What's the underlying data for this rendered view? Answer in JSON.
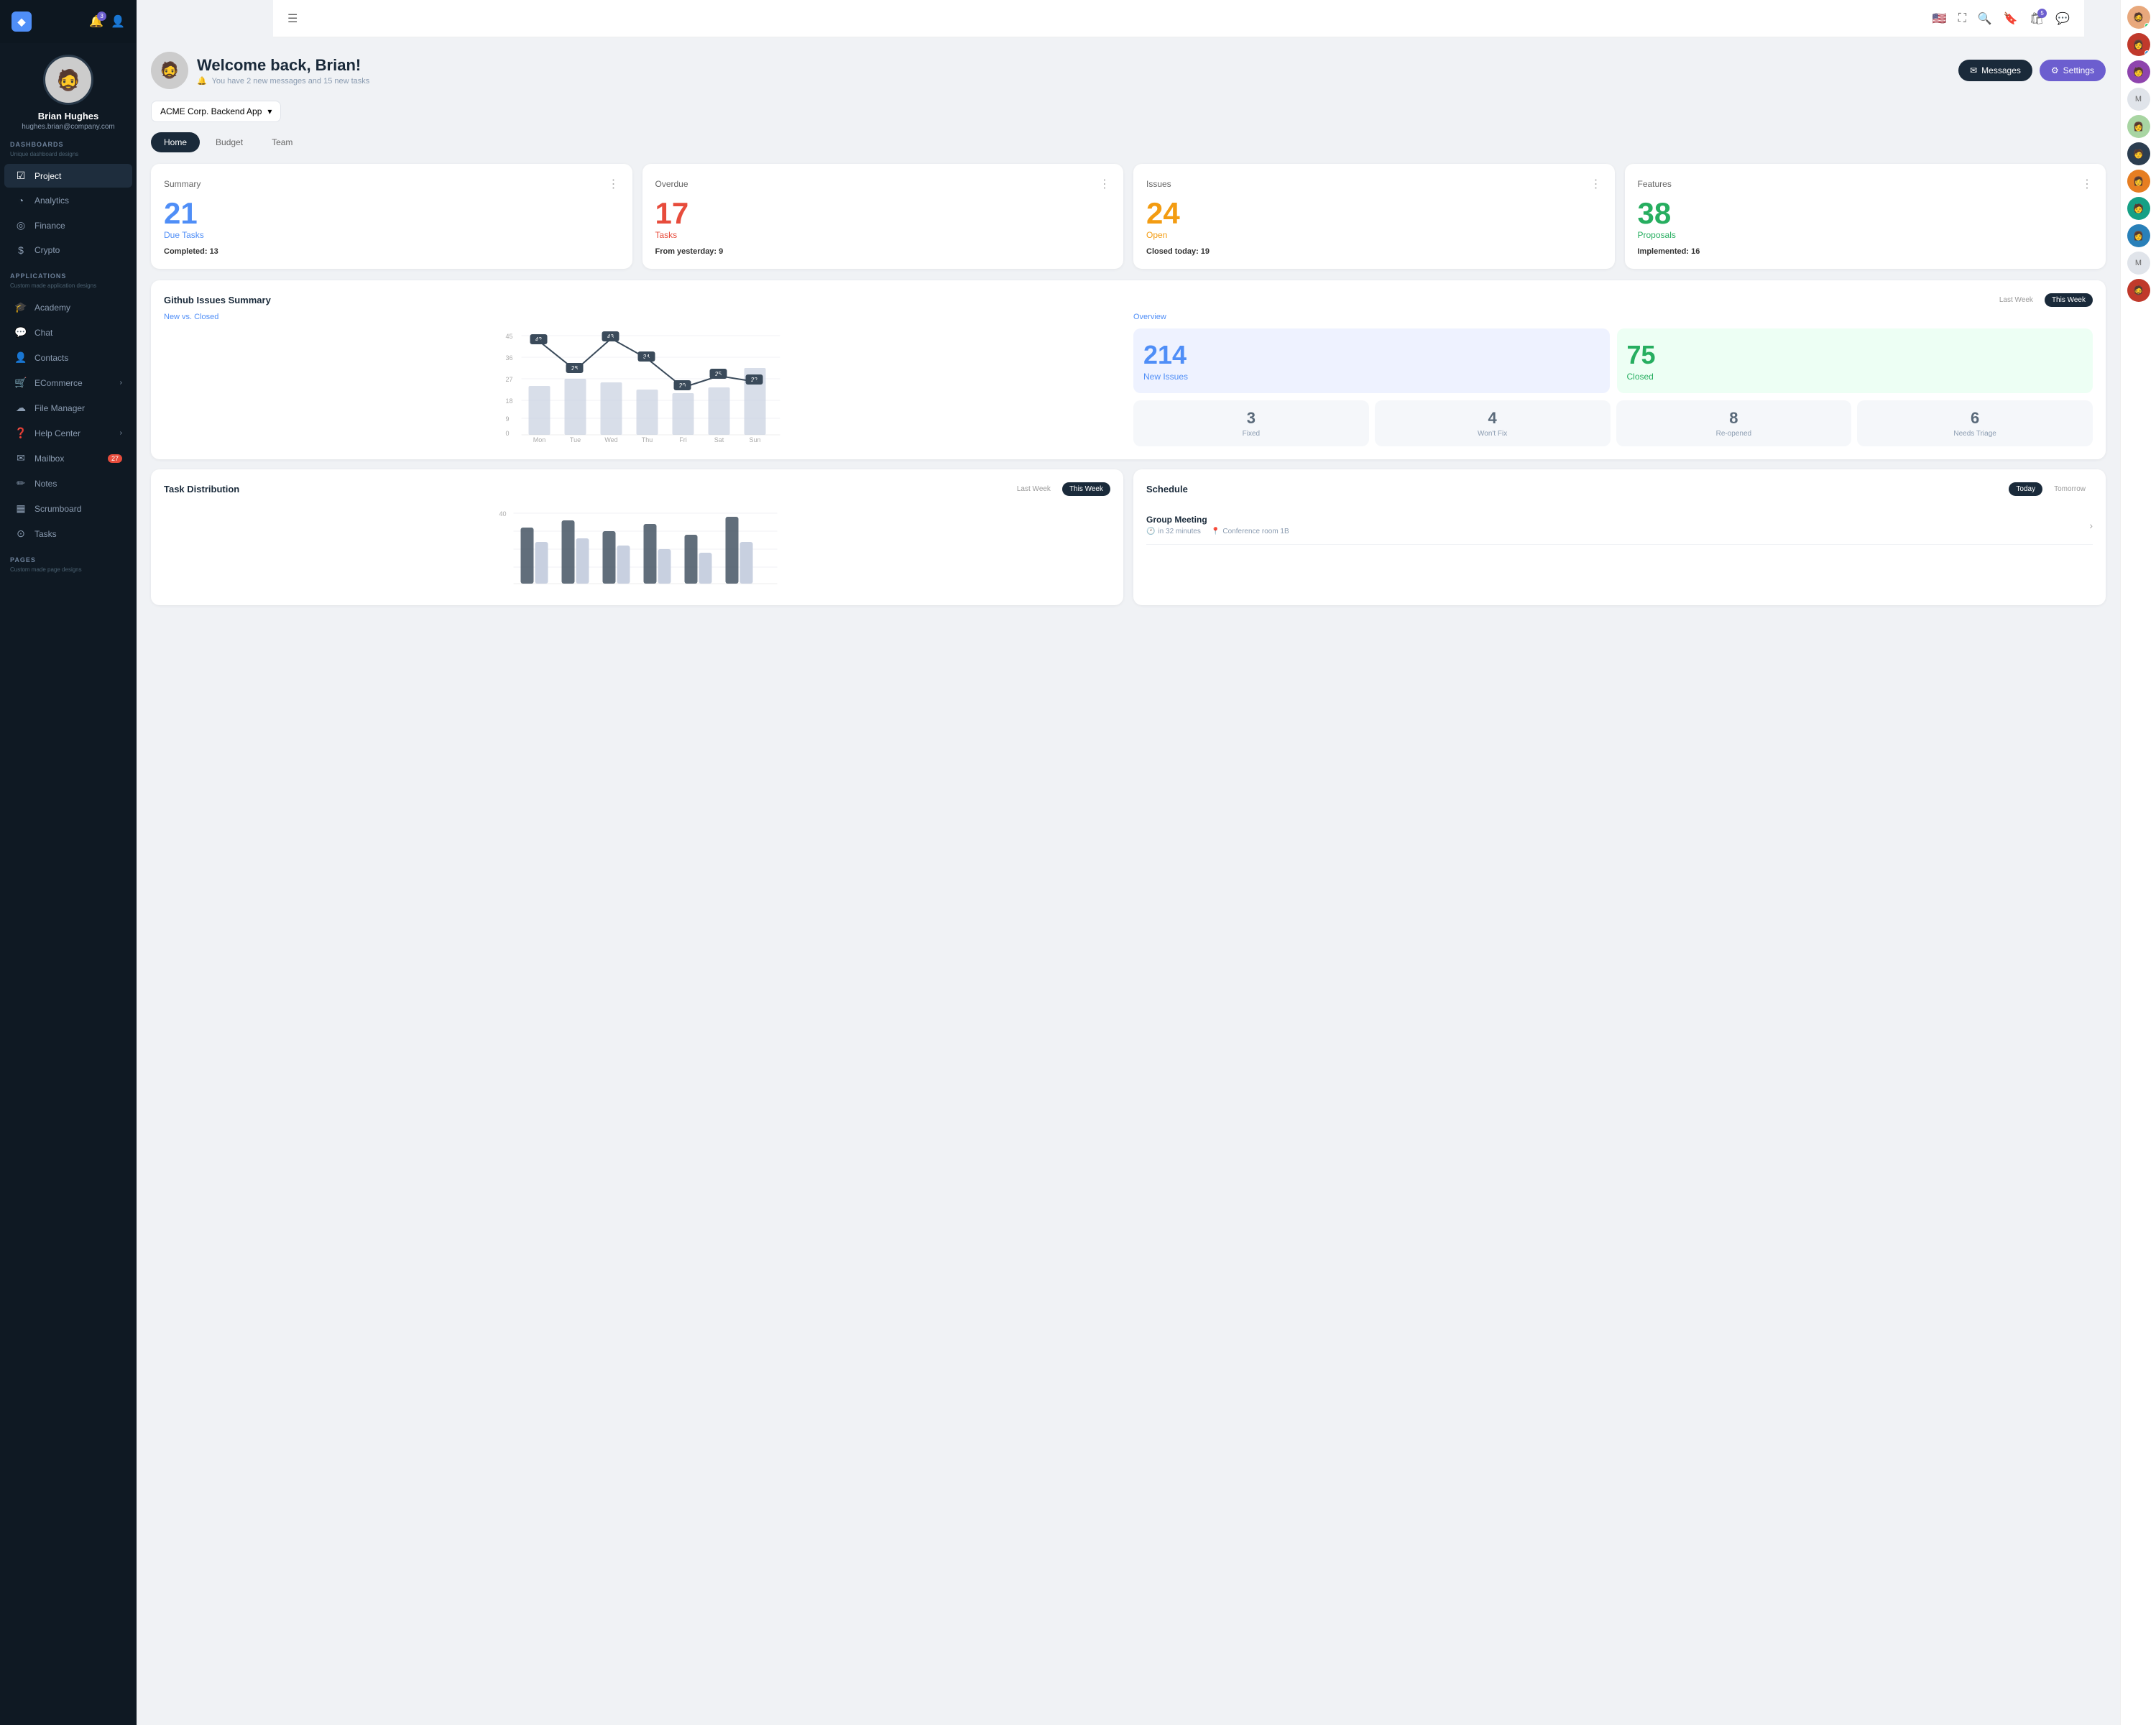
{
  "sidebar": {
    "logo": "◆",
    "notification_badge": "3",
    "user": {
      "name": "Brian Hughes",
      "email": "hughes.brian@company.com"
    },
    "dashboards_label": "DASHBOARDS",
    "dashboards_sub": "Unique dashboard designs",
    "nav_items": [
      {
        "id": "project",
        "icon": "☑",
        "label": "Project",
        "active": true
      },
      {
        "id": "analytics",
        "icon": "◔",
        "label": "Analytics",
        "active": false
      },
      {
        "id": "finance",
        "icon": "◎",
        "label": "Finance",
        "active": false
      },
      {
        "id": "crypto",
        "icon": "$",
        "label": "Crypto",
        "active": false
      }
    ],
    "applications_label": "APPLICATIONS",
    "applications_sub": "Custom made application designs",
    "app_items": [
      {
        "id": "academy",
        "icon": "🎓",
        "label": "Academy",
        "badge": null
      },
      {
        "id": "chat",
        "icon": "💬",
        "label": "Chat",
        "badge": null
      },
      {
        "id": "contacts",
        "icon": "👤",
        "label": "Contacts",
        "badge": null
      },
      {
        "id": "ecommerce",
        "icon": "🛒",
        "label": "ECommerce",
        "has_arrow": true
      },
      {
        "id": "filemanager",
        "icon": "☁",
        "label": "File Manager",
        "badge": null
      },
      {
        "id": "helpcenter",
        "icon": "❓",
        "label": "Help Center",
        "has_arrow": true
      },
      {
        "id": "mailbox",
        "icon": "✉",
        "label": "Mailbox",
        "badge": "27"
      },
      {
        "id": "notes",
        "icon": "✏",
        "label": "Notes",
        "badge": null
      },
      {
        "id": "scrumboard",
        "icon": "▦",
        "label": "Scrumboard",
        "badge": null
      },
      {
        "id": "tasks",
        "icon": "⊙",
        "label": "Tasks",
        "badge": null
      }
    ],
    "pages_label": "PAGES",
    "pages_sub": "Custom made page designs"
  },
  "topnav": {
    "menu_icon": "☰",
    "flag": "🇺🇸",
    "fullscreen_icon": "⛶",
    "search_icon": "🔍",
    "bookmark_icon": "🔖",
    "cart_icon": "🛍",
    "cart_badge": "5",
    "chat_icon": "💬"
  },
  "header": {
    "welcome": "Welcome back, Brian!",
    "subtitle": "You have 2 new messages and 15 new tasks",
    "messages_btn": "Messages",
    "settings_btn": "Settings"
  },
  "project_selector": {
    "label": "ACME Corp. Backend App"
  },
  "tabs": [
    {
      "id": "home",
      "label": "Home",
      "active": true
    },
    {
      "id": "budget",
      "label": "Budget",
      "active": false
    },
    {
      "id": "team",
      "label": "Team",
      "active": false
    }
  ],
  "stat_cards": [
    {
      "title": "Summary",
      "big_num": "21",
      "big_color": "blue",
      "big_label": "Due Tasks",
      "footer_text": "Completed:",
      "footer_val": "13"
    },
    {
      "title": "Overdue",
      "big_num": "17",
      "big_color": "red",
      "big_label": "Tasks",
      "footer_text": "From yesterday:",
      "footer_val": "9"
    },
    {
      "title": "Issues",
      "big_num": "24",
      "big_color": "orange",
      "big_label": "Open",
      "footer_text": "Closed today:",
      "footer_val": "19"
    },
    {
      "title": "Features",
      "big_num": "38",
      "big_color": "green",
      "big_label": "Proposals",
      "footer_text": "Implemented:",
      "footer_val": "16"
    }
  ],
  "github_summary": {
    "title": "Github Issues Summary",
    "last_week": "Last Week",
    "this_week": "This Week",
    "subtitle": "New vs. Closed",
    "chart_data": {
      "days": [
        "Mon",
        "Tue",
        "Wed",
        "Thu",
        "Fri",
        "Sat",
        "Sun"
      ],
      "line_values": [
        42,
        28,
        43,
        34,
        20,
        25,
        22
      ],
      "bar_heights": [
        70,
        60,
        65,
        50,
        45,
        55,
        80
      ]
    },
    "overview_label": "Overview",
    "new_issues": "214",
    "new_issues_label": "New Issues",
    "closed": "75",
    "closed_label": "Closed",
    "small_stats": [
      {
        "num": "3",
        "label": "Fixed"
      },
      {
        "num": "4",
        "label": "Won't Fix"
      },
      {
        "num": "8",
        "label": "Re-opened"
      },
      {
        "num": "6",
        "label": "Needs Triage"
      }
    ]
  },
  "task_distribution": {
    "title": "Task Distribution",
    "last_week": "Last Week",
    "this_week": "This Week",
    "max_label": "40"
  },
  "schedule": {
    "title": "Schedule",
    "today_btn": "Today",
    "tomorrow_btn": "Tomorrow",
    "items": [
      {
        "title": "Group Meeting",
        "time": "in 32 minutes",
        "location": "Conference room 1B"
      }
    ]
  },
  "right_panel": {
    "avatars": [
      {
        "color": "#e8a87c",
        "initial": ""
      },
      {
        "color": "#c0392b",
        "initial": ""
      },
      {
        "color": "#8e44ad",
        "initial": ""
      },
      {
        "color": "#b8c6db",
        "initial": "M"
      },
      {
        "color": "#27ae60",
        "initial": ""
      },
      {
        "color": "#2c3e50",
        "initial": ""
      },
      {
        "color": "#e67e22",
        "initial": ""
      },
      {
        "color": "#16a085",
        "initial": ""
      },
      {
        "color": "#2980b9",
        "initial": ""
      },
      {
        "color": "#b8c6db",
        "initial": "M"
      },
      {
        "color": "#c0392b",
        "initial": ""
      }
    ]
  }
}
